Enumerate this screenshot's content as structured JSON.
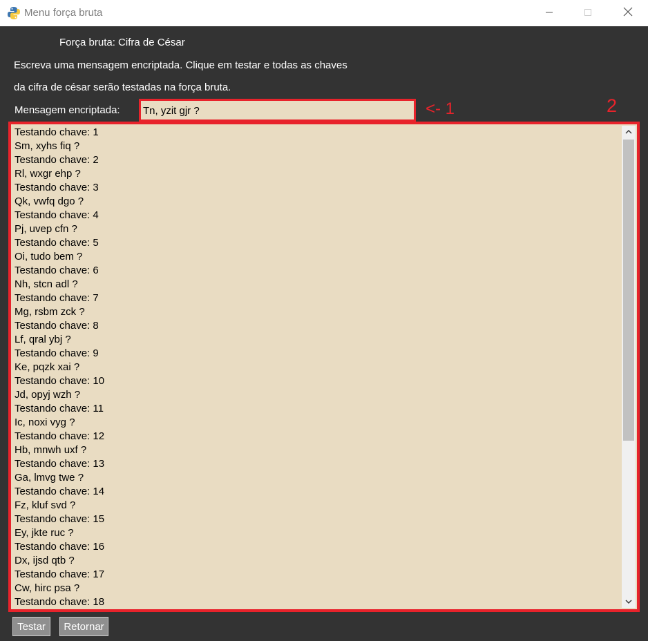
{
  "window": {
    "title": "Menu força bruta",
    "app_icon": "python-icon"
  },
  "header": {
    "heading": "Força bruta: Cifra de César",
    "description_line1": "Escreva uma mensagem encriptada. Clique em testar e todas as chaves",
    "description_line2": "da cifra de césar serão testadas na força bruta."
  },
  "input": {
    "label": "Mensagem encriptada:",
    "value": "Tn, yzit gjr ?"
  },
  "annotations": {
    "marker_1": "<- 1",
    "marker_2": "2",
    "color": "#e8232b"
  },
  "output": {
    "lines": [
      "Testando chave: 1",
      "Sm, xyhs fiq ?",
      "Testando chave: 2",
      "Rl, wxgr ehp ?",
      "Testando chave: 3",
      "Qk, vwfq dgo ?",
      "Testando chave: 4",
      "Pj, uvep cfn ?",
      "Testando chave: 5",
      "Oi, tudo bem ?",
      "Testando chave: 6",
      "Nh, stcn adl ?",
      "Testando chave: 7",
      "Mg, rsbm zck ?",
      "Testando chave: 8",
      "Lf, qral ybj ?",
      "Testando chave: 9",
      "Ke, pqzk xai ?",
      "Testando chave: 10",
      "Jd, opyj wzh ?",
      "Testando chave: 11",
      "Ic, noxi vyg ?",
      "Testando chave: 12",
      "Hb, mnwh uxf ?",
      "Testando chave: 13",
      "Ga, lmvg twe ?",
      "Testando chave: 14",
      "Fz, kluf svd ?",
      "Testando chave: 15",
      "Ey, jkte ruc ?",
      "Testando chave: 16",
      "Dx, ijsd qtb ?",
      "Testando chave: 17",
      "Cw, hirc psa ?",
      "Testando chave: 18"
    ]
  },
  "buttons": {
    "test_label": "Testar",
    "return_label": "Retornar"
  },
  "colors": {
    "background": "#333333",
    "field_bg": "#e9dcc2",
    "button_bg": "#8f8f8f"
  }
}
